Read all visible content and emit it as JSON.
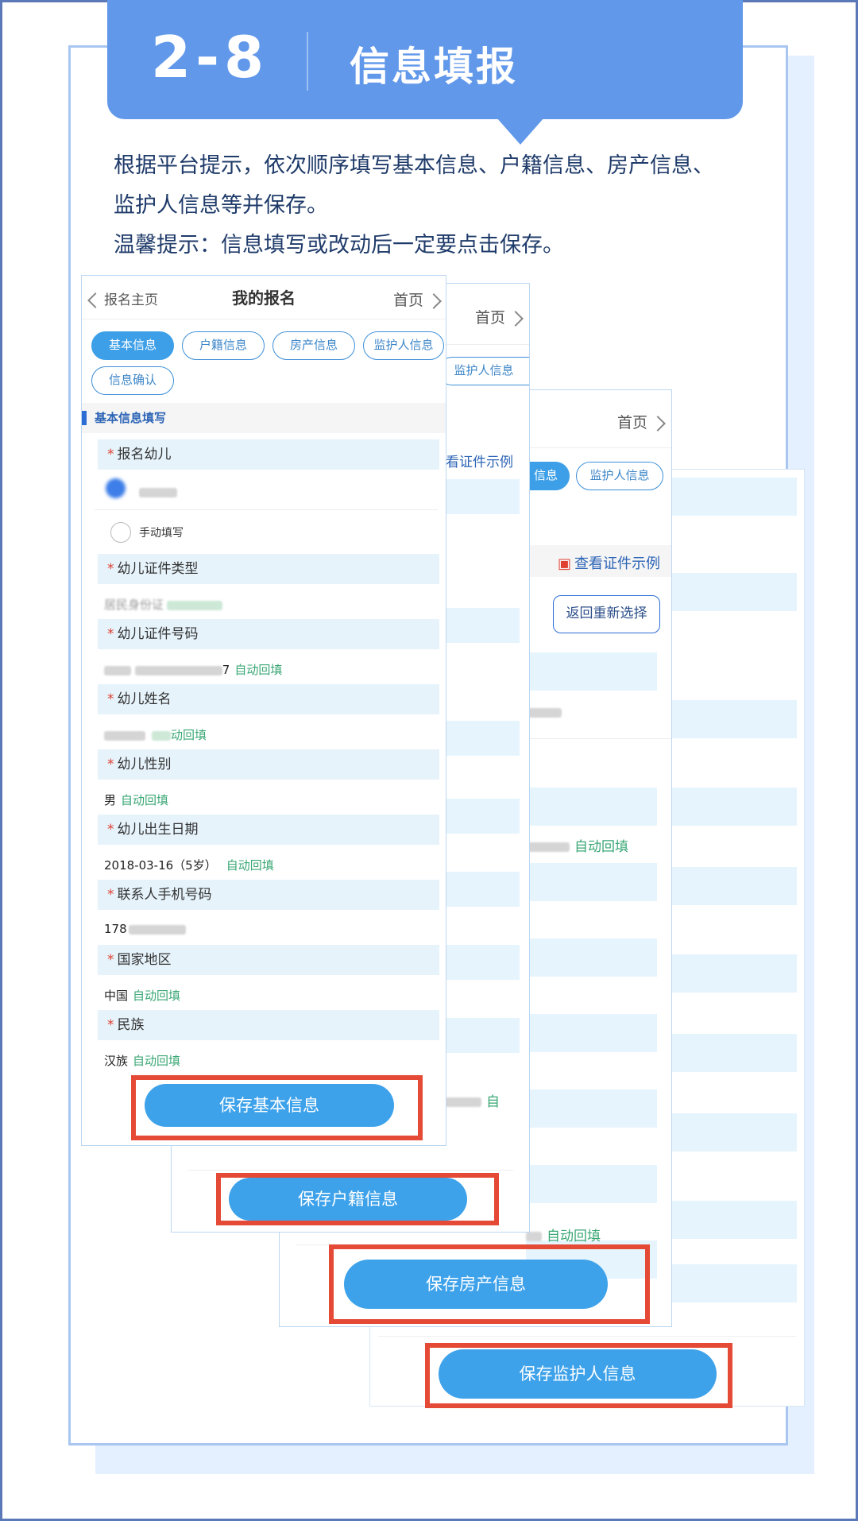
{
  "banner": {
    "number": "2-8",
    "title": "信息填报"
  },
  "instructions": {
    "line1": "根据平台提示，依次顺序填写基本信息、户籍信息、房产信息、",
    "line2": "监护人信息等并保存。",
    "line3": "温馨提示：信息填写或改动后一定要点击保存。"
  },
  "nav": {
    "back": "报名主页",
    "title": "我的报名",
    "home": "首页"
  },
  "tabs": [
    {
      "label": "基本信息",
      "active": true
    },
    {
      "label": "户籍信息",
      "active": false
    },
    {
      "label": "房产信息",
      "active": false
    },
    {
      "label": "监护人信息",
      "active": false
    },
    {
      "label": "信息确认",
      "active": false
    }
  ],
  "panel2": {
    "home": "首页",
    "tab_guardian": "监护人信息",
    "view_id_example": "看证件示例",
    "auto_fill_partial": "自"
  },
  "panel3": {
    "home": "首页",
    "tab_info_partial": "信息",
    "tab_guardian": "监护人信息",
    "view_id_example": "查看证件示例",
    "reselect": "返回重新选择",
    "auto_fill_1": "自动回填",
    "auto_fill_2": "自动回填"
  },
  "form": {
    "section_title": "基本信息填写",
    "child_label": "报名幼儿",
    "manual": "手动填写",
    "auto_fill": "自动回填",
    "fields": [
      {
        "label": "幼儿证件类型",
        "value": "居民身份证",
        "auto": ""
      },
      {
        "label": "幼儿证件号码",
        "value": "7",
        "auto": "自动回填"
      },
      {
        "label": "幼儿姓名",
        "value": "",
        "auto": "动回填"
      },
      {
        "label": "幼儿性别",
        "value": "男",
        "auto": "自动回填"
      },
      {
        "label": "幼儿出生日期",
        "value": "2018-03-16（5岁）",
        "auto": "自动回填"
      },
      {
        "label": "联系人手机号码",
        "value": "178",
        "auto": ""
      },
      {
        "label": "国家地区",
        "value": "中国",
        "auto": "自动回填"
      },
      {
        "label": "民族",
        "value": "汉族",
        "auto": "自动回填"
      }
    ]
  },
  "buttons": {
    "save_basic": "保存基本信息",
    "save_household": "保存户籍信息",
    "save_property": "保存房产信息",
    "save_guardian": "保存监护人信息"
  },
  "colors": {
    "banner": "#6198ea",
    "button": "#3ea2ea",
    "highlight": "#e44a35",
    "auto_fill": "#3aa774"
  }
}
